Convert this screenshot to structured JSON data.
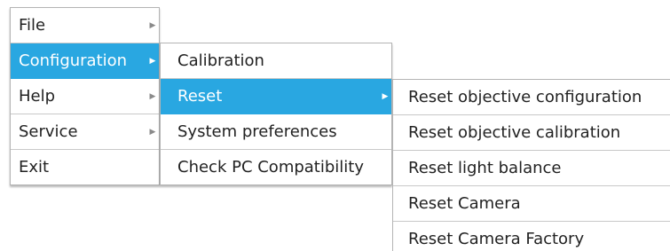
{
  "main_menu": {
    "items": [
      {
        "label": "File",
        "has_submenu": true
      },
      {
        "label": "Configuration",
        "has_submenu": true,
        "active": true
      },
      {
        "label": "Help",
        "has_submenu": true
      },
      {
        "label": "Service",
        "has_submenu": true
      },
      {
        "label": "Exit",
        "has_submenu": false
      }
    ]
  },
  "configuration_menu": {
    "items": [
      {
        "label": "Calibration",
        "has_submenu": false
      },
      {
        "label": "Reset",
        "has_submenu": true,
        "active": true
      },
      {
        "label": "System preferences",
        "has_submenu": false
      },
      {
        "label": "Check PC Compatibility",
        "has_submenu": false
      }
    ]
  },
  "reset_menu": {
    "items": [
      {
        "label": "Reset objective configuration"
      },
      {
        "label": "Reset objective calibration"
      },
      {
        "label": "Reset light balance"
      },
      {
        "label": "Reset Camera"
      },
      {
        "label": "Reset Camera Factory"
      }
    ]
  },
  "icons": {
    "submenu_arrow": "submenu-arrow-icon",
    "arrow_glyph": "▶"
  },
  "colors": {
    "highlight": "#29a7e1",
    "highlight_text": "#ffffff",
    "menu_text": "#222222",
    "border": "#b4b4b4"
  }
}
